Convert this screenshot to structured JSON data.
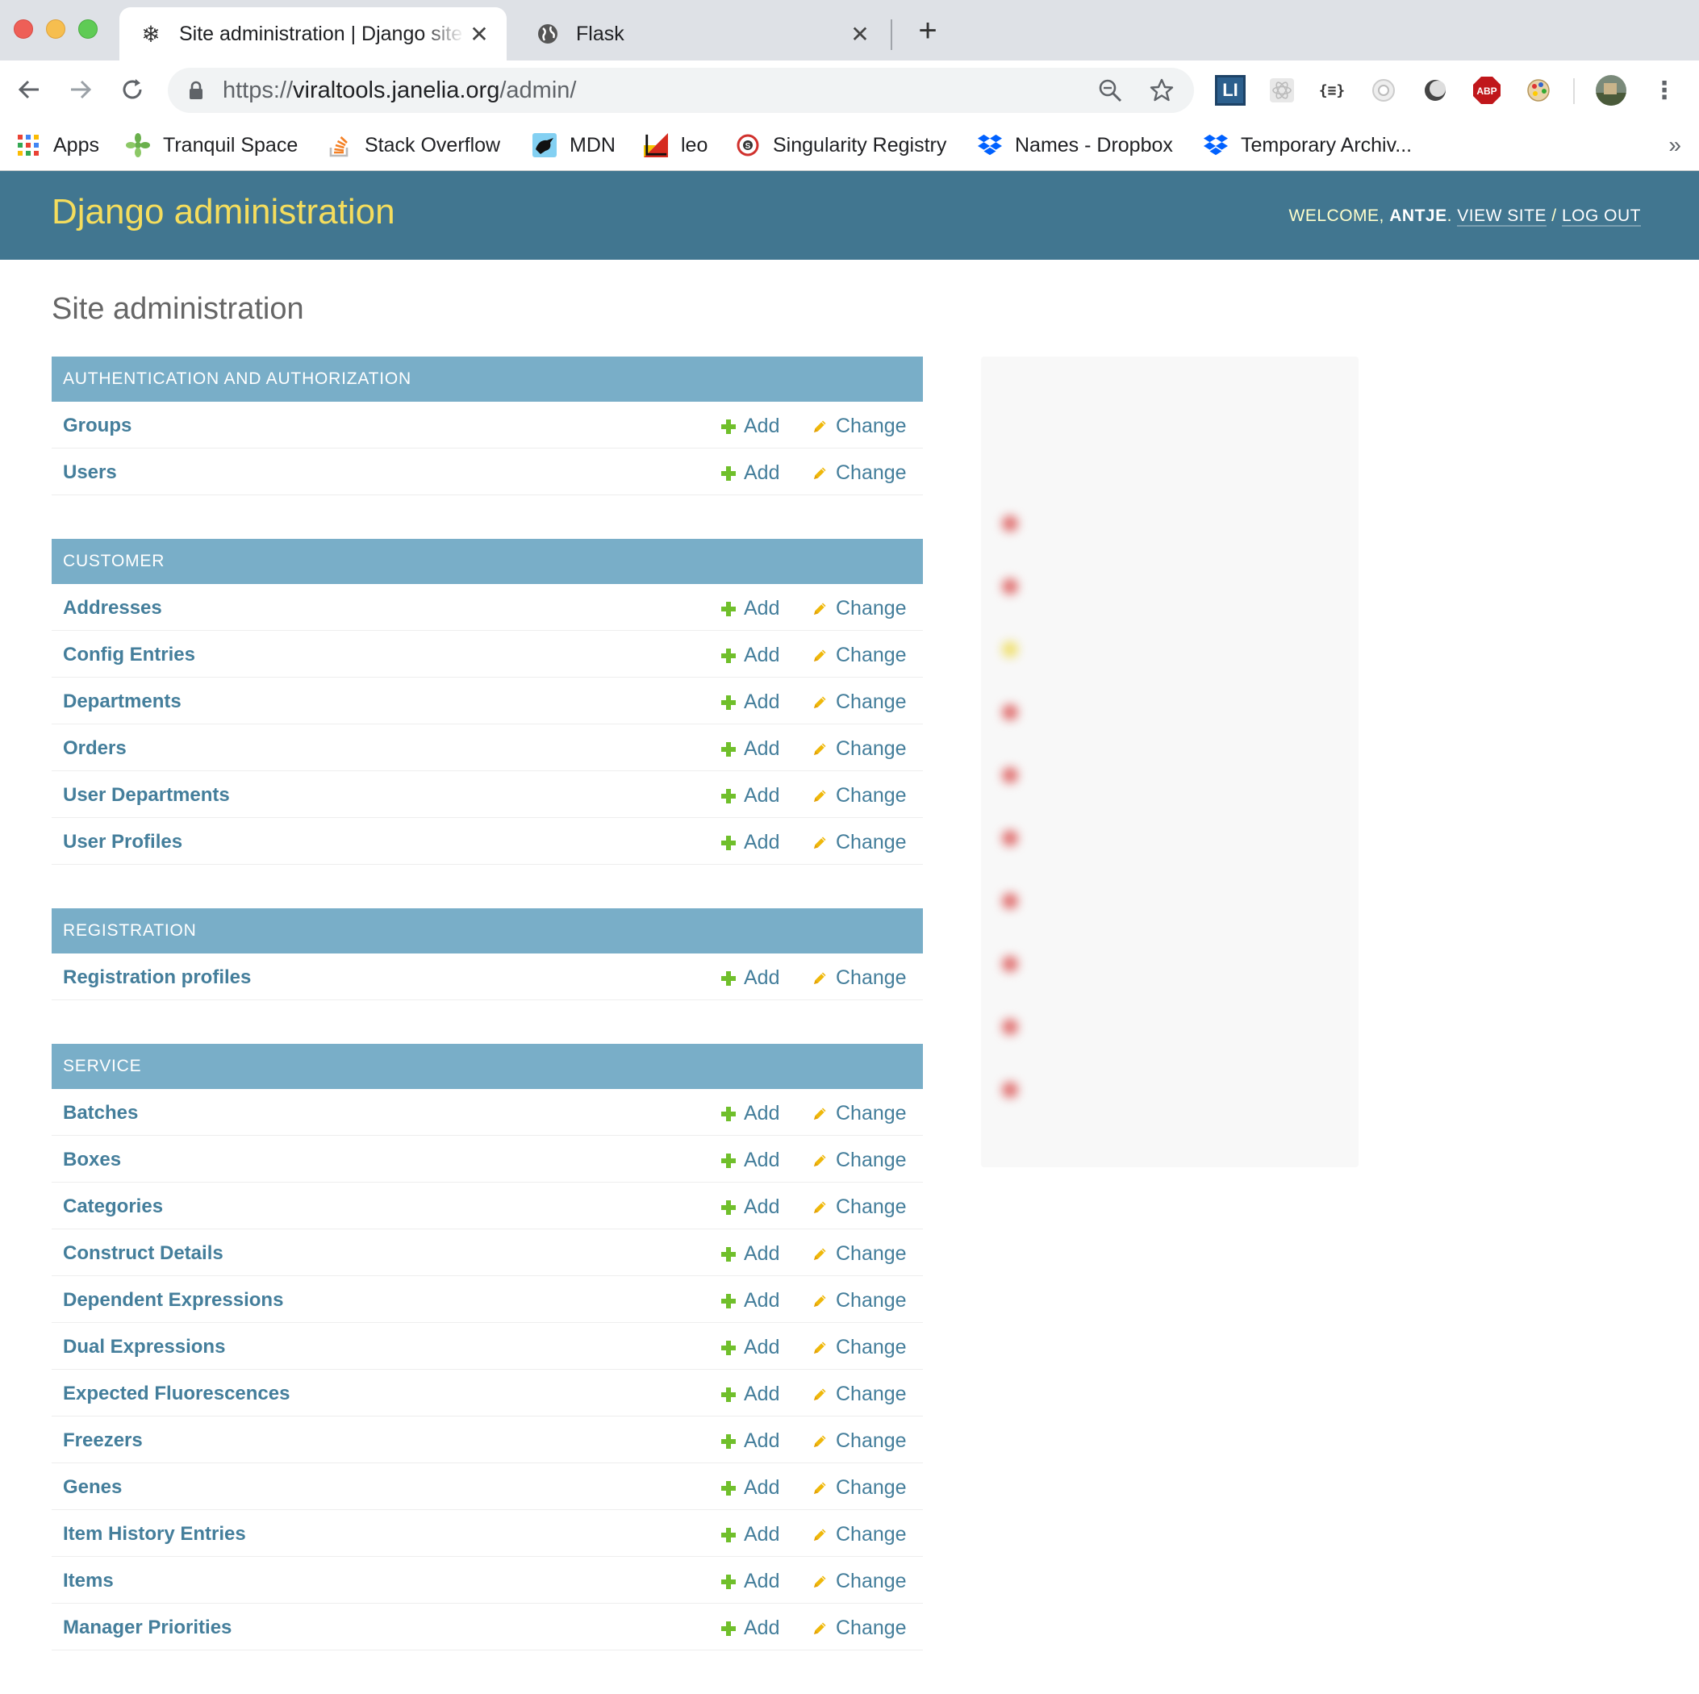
{
  "browser": {
    "tabs": [
      {
        "title": "Site administration | Django site admin",
        "active": true,
        "icon": "django-snowflake-icon"
      },
      {
        "title": "Flask",
        "active": false,
        "icon": "globe-icon"
      }
    ],
    "url_scheme": "https://",
    "url_host": "viraltools.janelia.org",
    "url_path": "/admin/",
    "bookmarks": [
      {
        "label": "Apps",
        "icon": "apps-grid-icon"
      },
      {
        "label": "Tranquil Space",
        "icon": "leaf-icon"
      },
      {
        "label": "Stack Overflow",
        "icon": "stackoverflow-icon"
      },
      {
        "label": "MDN",
        "icon": "mdn-icon"
      },
      {
        "label": "leo",
        "icon": "leo-icon"
      },
      {
        "label": "Singularity Registry",
        "icon": "singularity-icon"
      },
      {
        "label": "Names - Dropbox",
        "icon": "dropbox-icon"
      },
      {
        "label": "Temporary Archiv...",
        "icon": "dropbox-icon"
      }
    ],
    "more_bookmarks": "»",
    "extensions": {
      "li": "LI",
      "json": "{≡}",
      "abp": "ABP"
    }
  },
  "header": {
    "brand": "Django administration",
    "welcome": "Welcome,",
    "user": "antje",
    "view_site": "View site",
    "separator": "/",
    "logout": "Log out",
    "colors": {
      "header_bg": "#417690",
      "brand": "#f5dd5d",
      "caption_bg": "#79aec8",
      "link": "#447e9b",
      "add_icon": "#70bf2b",
      "change_icon": "#efb80b"
    }
  },
  "content": {
    "title": "Site administration",
    "add_label": "Add",
    "change_label": "Change",
    "modules": [
      {
        "caption": "Authentication and Authorization",
        "models": [
          "Groups",
          "Users"
        ]
      },
      {
        "caption": "Customer",
        "models": [
          "Addresses",
          "Config Entries",
          "Departments",
          "Orders",
          "User Departments",
          "User Profiles"
        ]
      },
      {
        "caption": "Registration",
        "models": [
          "Registration profiles"
        ]
      },
      {
        "caption": "Service",
        "models": [
          "Batches",
          "Boxes",
          "Categories",
          "Construct Details",
          "Dependent Expressions",
          "Dual Expressions",
          "Expected Fluorescences",
          "Freezers",
          "Genes",
          "Item History Entries",
          "Items",
          "Manager Priorities"
        ]
      }
    ]
  },
  "recent_actions": {
    "blurred": true
  }
}
